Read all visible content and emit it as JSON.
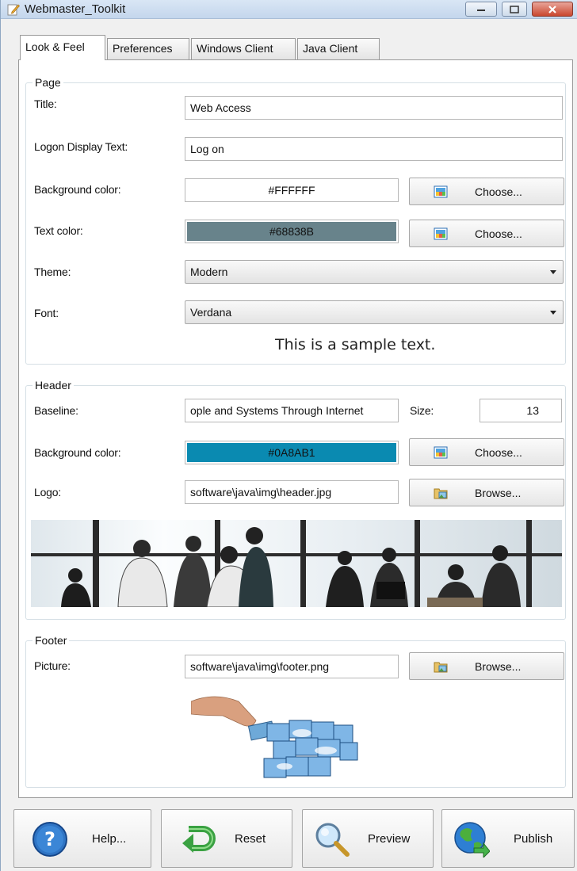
{
  "window": {
    "title": "Webmaster_Toolkit"
  },
  "tabs": [
    "Look & Feel",
    "Preferences",
    "Windows Client",
    "Java Client"
  ],
  "page_group": {
    "legend": "Page",
    "title_label": "Title:",
    "title_value": "Web Access",
    "logon_label": "Logon Display Text:",
    "logon_value": "Log on",
    "bg_label": "Background color:",
    "bg_value": "#FFFFFF",
    "text_color_label": "Text color:",
    "text_color_value": "#68838B",
    "theme_label": "Theme:",
    "theme_value": "Modern",
    "font_label": "Font:",
    "font_value": "Verdana",
    "sample_text": "This is a sample text.",
    "choose_label": "Choose..."
  },
  "header_group": {
    "legend": "Header",
    "baseline_label": "Baseline:",
    "baseline_value": "ople and Systems Through Internet",
    "size_label": "Size:",
    "size_value": "13",
    "bg_label": "Background color:",
    "bg_value": "#0A8AB1",
    "logo_label": "Logo:",
    "logo_value": "software\\java\\img\\header.jpg",
    "choose_label": "Choose...",
    "browse_label": "Browse..."
  },
  "footer_group": {
    "legend": "Footer",
    "picture_label": "Picture:",
    "picture_value": "software\\java\\img\\footer.png",
    "browse_label": "Browse..."
  },
  "actions": {
    "help": "Help...",
    "reset": "Reset",
    "preview": "Preview",
    "publish": "Publish"
  },
  "colors": {
    "page_background": "#FFFFFF",
    "text_color": "#68838B",
    "header_background": "#0A8AB1"
  }
}
